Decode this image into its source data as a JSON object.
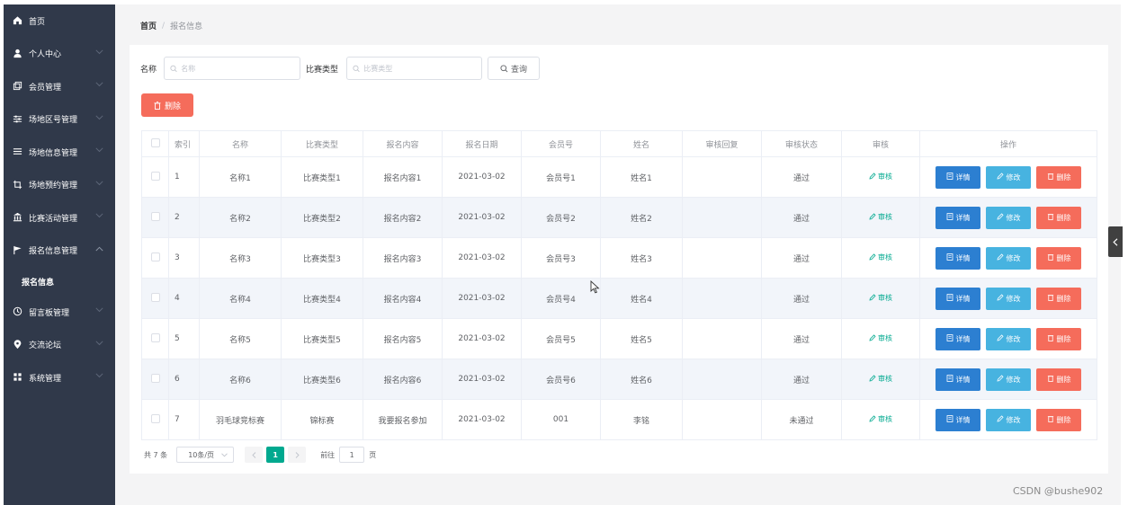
{
  "sidebar": {
    "items": [
      {
        "label": "首页",
        "icon": "home-icon",
        "expandable": false
      },
      {
        "label": "个人中心",
        "icon": "user-icon",
        "expandable": true
      },
      {
        "label": "会员管理",
        "icon": "copy-icon",
        "expandable": true
      },
      {
        "label": "场地区号管理",
        "icon": "sliders-icon",
        "expandable": true
      },
      {
        "label": "场地信息管理",
        "icon": "list-icon",
        "expandable": true
      },
      {
        "label": "场地预约管理",
        "icon": "crop-icon",
        "expandable": true
      },
      {
        "label": "比赛活动管理",
        "icon": "bank-icon",
        "expandable": true
      },
      {
        "label": "报名信息管理",
        "icon": "flag-icon",
        "expandable": true,
        "expanded": true
      }
    ],
    "submenu": {
      "label": "报名信息"
    },
    "items_after": [
      {
        "label": "留言板管理",
        "icon": "clock-icon",
        "expandable": true
      },
      {
        "label": "交流论坛",
        "icon": "location-icon",
        "expandable": true
      },
      {
        "label": "系统管理",
        "icon": "grid-icon",
        "expandable": true
      }
    ]
  },
  "breadcrumb": {
    "home": "首页",
    "separator": "/",
    "current": "报名信息"
  },
  "search": {
    "name_label": "名称",
    "name_placeholder": "名称",
    "type_label": "比赛类型",
    "type_placeholder": "比赛类型",
    "query_label": "查询"
  },
  "toolbar": {
    "delete_label": "删除"
  },
  "table": {
    "headers": [
      "索引",
      "名称",
      "比赛类型",
      "报名内容",
      "报名日期",
      "会员号",
      "姓名",
      "审核回复",
      "审核状态",
      "审核",
      "操作"
    ],
    "audit_label": "审核",
    "actions": {
      "detail": "详情",
      "edit": "修改",
      "delete": "删除"
    },
    "rows": [
      {
        "idx": "1",
        "name": "名称1",
        "type": "比赛类型1",
        "content": "报名内容1",
        "date": "2021-03-02",
        "member": "会员号1",
        "person": "姓名1",
        "reply": "",
        "status": "通过"
      },
      {
        "idx": "2",
        "name": "名称2",
        "type": "比赛类型2",
        "content": "报名内容2",
        "date": "2021-03-02",
        "member": "会员号2",
        "person": "姓名2",
        "reply": "",
        "status": "通过"
      },
      {
        "idx": "3",
        "name": "名称3",
        "type": "比赛类型3",
        "content": "报名内容3",
        "date": "2021-03-02",
        "member": "会员号3",
        "person": "姓名3",
        "reply": "",
        "status": "通过"
      },
      {
        "idx": "4",
        "name": "名称4",
        "type": "比赛类型4",
        "content": "报名内容4",
        "date": "2021-03-02",
        "member": "会员号4",
        "person": "姓名4",
        "reply": "",
        "status": "通过"
      },
      {
        "idx": "5",
        "name": "名称5",
        "type": "比赛类型5",
        "content": "报名内容5",
        "date": "2021-03-02",
        "member": "会员号5",
        "person": "姓名5",
        "reply": "",
        "status": "通过"
      },
      {
        "idx": "6",
        "name": "名称6",
        "type": "比赛类型6",
        "content": "报名内容6",
        "date": "2021-03-02",
        "member": "会员号6",
        "person": "姓名6",
        "reply": "",
        "status": "通过"
      },
      {
        "idx": "7",
        "name": "羽毛球竞标赛",
        "type": "锦标赛",
        "content": "我要报名参加",
        "date": "2021-03-02",
        "member": "001",
        "person": "李铭",
        "reply": "",
        "status": "未通过"
      }
    ]
  },
  "pagination": {
    "total_text": "共 7 条",
    "page_size": "10条/页",
    "current_page": "1",
    "goto_label": "前往",
    "goto_value": "1",
    "page_suffix": "页"
  },
  "watermark": "CSDN @bushe902",
  "colors": {
    "sidebar_bg": "#30394a",
    "primary": "#00a98f",
    "danger": "#f56c5b",
    "detail": "#2c7fd1",
    "edit": "#47b3e0"
  }
}
